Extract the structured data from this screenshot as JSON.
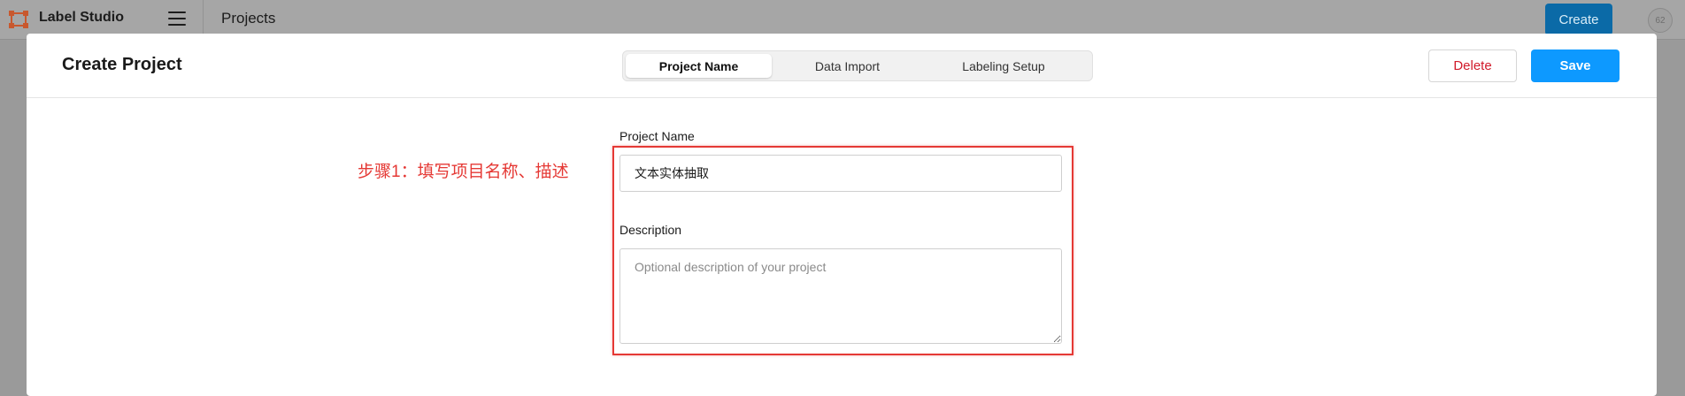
{
  "topbar": {
    "app_name": "Label Studio",
    "logo_icon": "label-studio-logo-icon",
    "menu_icon": "hamburger-menu-icon",
    "page_title": "Projects",
    "create_label": "Create",
    "avatar_text": "62"
  },
  "modal": {
    "title": "Create Project",
    "tabs": [
      {
        "label": "Project Name",
        "active": true
      },
      {
        "label": "Data Import",
        "active": false
      },
      {
        "label": "Labeling Setup",
        "active": false
      }
    ],
    "delete_label": "Delete",
    "save_label": "Save",
    "annotation_text": "步骤1：填写项目名称、描述",
    "project_name": {
      "label": "Project Name",
      "value": "文本实体抽取"
    },
    "description": {
      "label": "Description",
      "placeholder": "Optional description of your project",
      "value": ""
    }
  },
  "colors": {
    "primary": "#0d99ff",
    "danger": "#d11a2a",
    "annotation": "#e53935",
    "logo": "#e0643a"
  }
}
